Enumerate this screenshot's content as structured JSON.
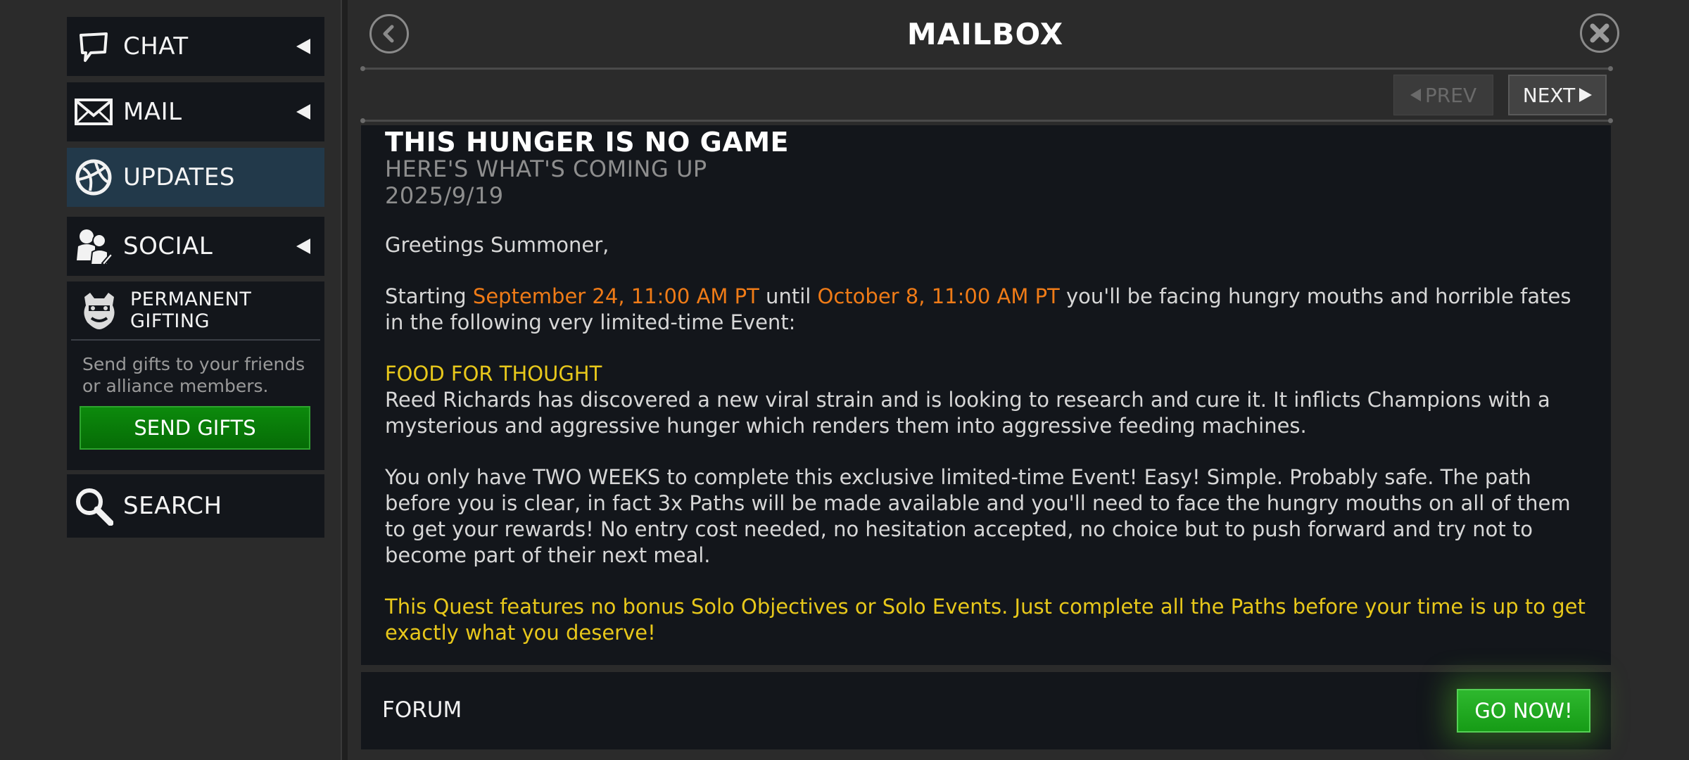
{
  "sidebar": {
    "items": [
      {
        "label": "CHAT",
        "icon": "chat-bubble-icon"
      },
      {
        "label": "MAIL",
        "icon": "envelope-icon"
      },
      {
        "label": "UPDATES",
        "icon": "globe-icon"
      },
      {
        "label": "SOCIAL",
        "icon": "people-icon"
      }
    ],
    "gifting": {
      "title_line1": "PERMANENT",
      "title_line2": "GIFTING",
      "description": "Send gifts to your friends or alliance members.",
      "button_label": "SEND GIFTS",
      "icon": "character-face-icon"
    },
    "search": {
      "label": "SEARCH",
      "icon": "search-icon"
    }
  },
  "header": {
    "title": "MAILBOX",
    "back_icon": "chevron-left-icon",
    "close_icon": "close-icon"
  },
  "pager": {
    "prev_label": "PREV",
    "next_label": "NEXT",
    "prev_enabled": false
  },
  "message": {
    "title": "THIS HUNGER IS NO GAME",
    "subtitle": "HERE'S WHAT'S COMING UP",
    "date": "2025/9/19",
    "greeting": "Greetings Summoner,",
    "p1_start": "Starting ",
    "p1_date1": "September 24, 11:00 AM PT",
    "p1_until": " until ",
    "p1_date2": "October 8, 11:00 AM PT",
    "p1_rest": " you'll be facing hungry mouths and horrible fates in the following very limited-time Event:",
    "event_name": "FOOD FOR THOUGHT",
    "event_desc": "Reed Richards has discovered a new viral strain and is looking to research and cure it. It inflicts Champions with a mysterious and aggressive hunger which renders them into aggressive feeding machines.",
    "p3": "You only have TWO WEEKS to complete this exclusive limited-time Event! Easy! Simple. Probably safe. The path before you is clear, in fact 3x Paths will be made available and you'll need to face the hungry mouths on all of them to get your rewards! No entry cost needed, no hesitation accepted, no choice but to push forward and try not to become part of their next meal.",
    "p4": "This Quest features no bonus Solo Objectives or Solo Events. Just complete all the Paths before your time is up to get exactly what you deserve!"
  },
  "footer": {
    "forum_label": "FORUM",
    "go_label": "GO NOW!"
  },
  "colors": {
    "accent_orange": "#ef7b17",
    "accent_yellow": "#e8c81b",
    "button_green": "#169c16",
    "active_tab": "#22394a",
    "panel": "#13161b",
    "background": "#2b2b2b"
  }
}
